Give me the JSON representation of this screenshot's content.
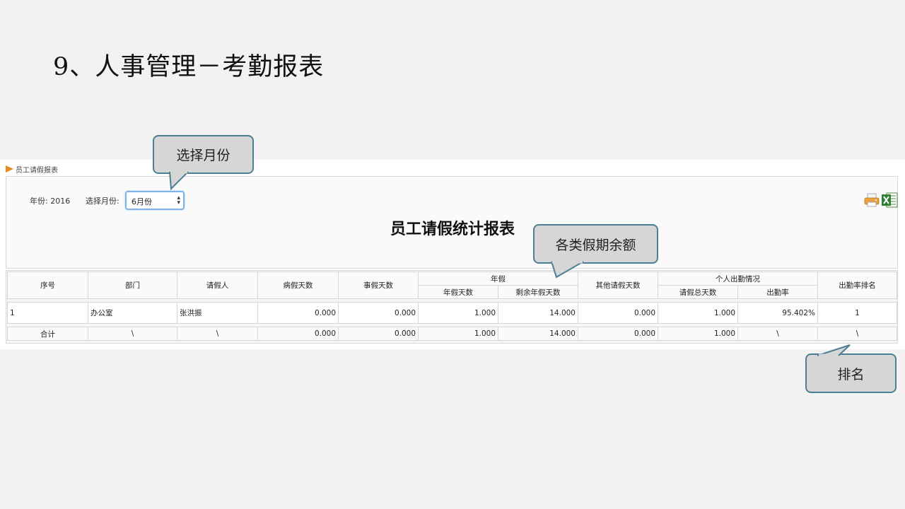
{
  "slide": {
    "title": "9、人事管理－考勤报表"
  },
  "panel": {
    "header": "员工请假报表"
  },
  "filter": {
    "year_label": "年份:",
    "year_value": "2016",
    "month_label": "选择月份:",
    "month_selected": "6月份"
  },
  "report": {
    "title": "员工请假统计报表",
    "headers": {
      "seq": "序号",
      "dept": "部门",
      "person": "请假人",
      "sick": "病假天数",
      "personal": "事假天数",
      "annual": "年假",
      "annual_days": "年假天数",
      "annual_remaining": "剩余年假天数",
      "other": "其他请假天数",
      "attendance": "个人出勤情况",
      "total_leave": "请假总天数",
      "attendance_rate": "出勤率",
      "rank": "出勤率排名"
    },
    "rows": [
      {
        "seq": "1",
        "dept": "办公室",
        "person": "张洪振",
        "sick": "0.000",
        "personal": "0.000",
        "annual_days": "1.000",
        "annual_remaining": "14.000",
        "other": "0.000",
        "total_leave": "1.000",
        "attendance_rate": "95.402%",
        "rank": "1"
      }
    ],
    "total": {
      "label": "合计",
      "dept": "\\",
      "person": "\\",
      "sick": "0.000",
      "personal": "0.000",
      "annual_days": "1.000",
      "annual_remaining": "14.000",
      "other": "0.000",
      "total_leave": "1.000",
      "attendance_rate": "\\",
      "rank": "\\"
    }
  },
  "callouts": {
    "month": "选择月份",
    "balance": "各类假期余额",
    "rank": "排名"
  },
  "icons": {
    "print": "print-icon",
    "excel": "excel-export-icon",
    "panel_arrow": "arrow-right-icon"
  },
  "colors": {
    "accent_orange": "#e58a1f",
    "callout_border": "#4a7f96",
    "callout_fill": "#d6d6d6",
    "select_focus": "#7fb2e5"
  }
}
